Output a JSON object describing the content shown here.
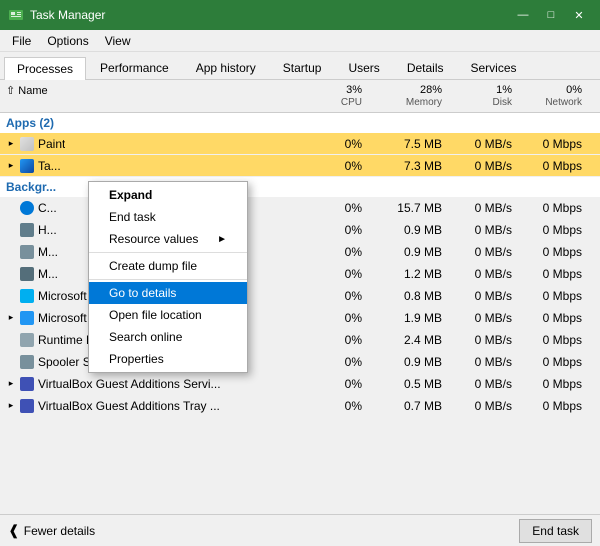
{
  "titleBar": {
    "title": "Task Manager",
    "minimize": "—",
    "maximize": "□",
    "close": "✕"
  },
  "menuBar": {
    "items": [
      "File",
      "Options",
      "View"
    ]
  },
  "tabs": [
    {
      "label": "Processes",
      "active": false
    },
    {
      "label": "Performance",
      "active": false
    },
    {
      "label": "App history",
      "active": false
    },
    {
      "label": "Startup",
      "active": false
    },
    {
      "label": "Users",
      "active": false
    },
    {
      "label": "Details",
      "active": false
    },
    {
      "label": "Services",
      "active": false
    }
  ],
  "columns": [
    {
      "label": "Name",
      "sublabel": "",
      "align": "left"
    },
    {
      "label": "3%",
      "sublabel": "CPU",
      "align": "right"
    },
    {
      "label": "28%",
      "sublabel": "Memory",
      "align": "right"
    },
    {
      "label": "1%",
      "sublabel": "Disk",
      "align": "right"
    },
    {
      "label": "0%",
      "sublabel": "Network",
      "align": "right"
    }
  ],
  "sections": [
    {
      "label": "Apps (2)",
      "rows": [
        {
          "name": "Paint",
          "cpu": "0%",
          "memory": "7.5 MB",
          "disk": "0 MB/s",
          "network": "0 Mbps",
          "highlight": true,
          "icon": "paint",
          "expandable": true
        },
        {
          "name": "Ta...",
          "cpu": "0%",
          "memory": "7.3 MB",
          "disk": "0 MB/s",
          "network": "0 Mbps",
          "highlight": true,
          "icon": "taskmanager",
          "expandable": true
        }
      ]
    },
    {
      "label": "Background processes",
      "rows": [
        {
          "name": "C...",
          "cpu": "0%",
          "memory": "15.7 MB",
          "disk": "0 MB/s",
          "network": "0 Mbps",
          "highlight": false,
          "icon": "cortana",
          "expandable": false
        },
        {
          "name": "H...",
          "cpu": "0%",
          "memory": "0.9 MB",
          "disk": "0 MB/s",
          "network": "0 Mbps",
          "highlight": false,
          "icon": "host",
          "expandable": false
        },
        {
          "name": "M...",
          "cpu": "0%",
          "memory": "0.9 MB",
          "disk": "0 MB/s",
          "network": "0 Mbps",
          "highlight": false,
          "icon": "msi",
          "expandable": false
        },
        {
          "name": "M...",
          "cpu": "0%",
          "memory": "1.2 MB",
          "disk": "0 MB/s",
          "network": "0 Mbps",
          "highlight": false,
          "icon": "msi",
          "expandable": false
        },
        {
          "name": "Microsoft Skype (32 bit)",
          "cpu": "0%",
          "memory": "0.8 MB",
          "disk": "0 MB/s",
          "network": "0 Mbps",
          "highlight": false,
          "icon": "skype",
          "expandable": false
        },
        {
          "name": "Microsoft Windows Search Inde...",
          "cpu": "0%",
          "memory": "1.9 MB",
          "disk": "0 MB/s",
          "network": "0 Mbps",
          "highlight": false,
          "icon": "search",
          "expandable": true
        },
        {
          "name": "Runtime Broker",
          "cpu": "0%",
          "memory": "2.4 MB",
          "disk": "0 MB/s",
          "network": "0 Mbps",
          "highlight": false,
          "icon": "runtime",
          "expandable": false
        },
        {
          "name": "Spooler SubSystem App",
          "cpu": "0%",
          "memory": "0.9 MB",
          "disk": "0 MB/s",
          "network": "0 Mbps",
          "highlight": false,
          "icon": "spooler",
          "expandable": false
        },
        {
          "name": "VirtualBox Guest Additions Servi...",
          "cpu": "0%",
          "memory": "0.5 MB",
          "disk": "0 MB/s",
          "network": "0 Mbps",
          "highlight": false,
          "icon": "vbox",
          "expandable": true
        },
        {
          "name": "VirtualBox Guest Additions Tray ...",
          "cpu": "0%",
          "memory": "0.7 MB",
          "disk": "0 MB/s",
          "network": "0 Mbps",
          "highlight": false,
          "icon": "vbox",
          "expandable": true
        }
      ]
    }
  ],
  "contextMenu": {
    "items": [
      {
        "label": "Expand",
        "type": "normal",
        "bold": true
      },
      {
        "label": "End task",
        "type": "normal"
      },
      {
        "label": "Resource values",
        "type": "submenu"
      },
      {
        "type": "separator"
      },
      {
        "label": "Create dump file",
        "type": "normal"
      },
      {
        "type": "separator"
      },
      {
        "label": "Go to details",
        "type": "highlighted"
      },
      {
        "label": "Open file location",
        "type": "normal"
      },
      {
        "label": "Search online",
        "type": "normal"
      },
      {
        "label": "Properties",
        "type": "normal"
      }
    ]
  },
  "statusBar": {
    "fewerDetails": "Fewer details",
    "endTask": "End task"
  }
}
